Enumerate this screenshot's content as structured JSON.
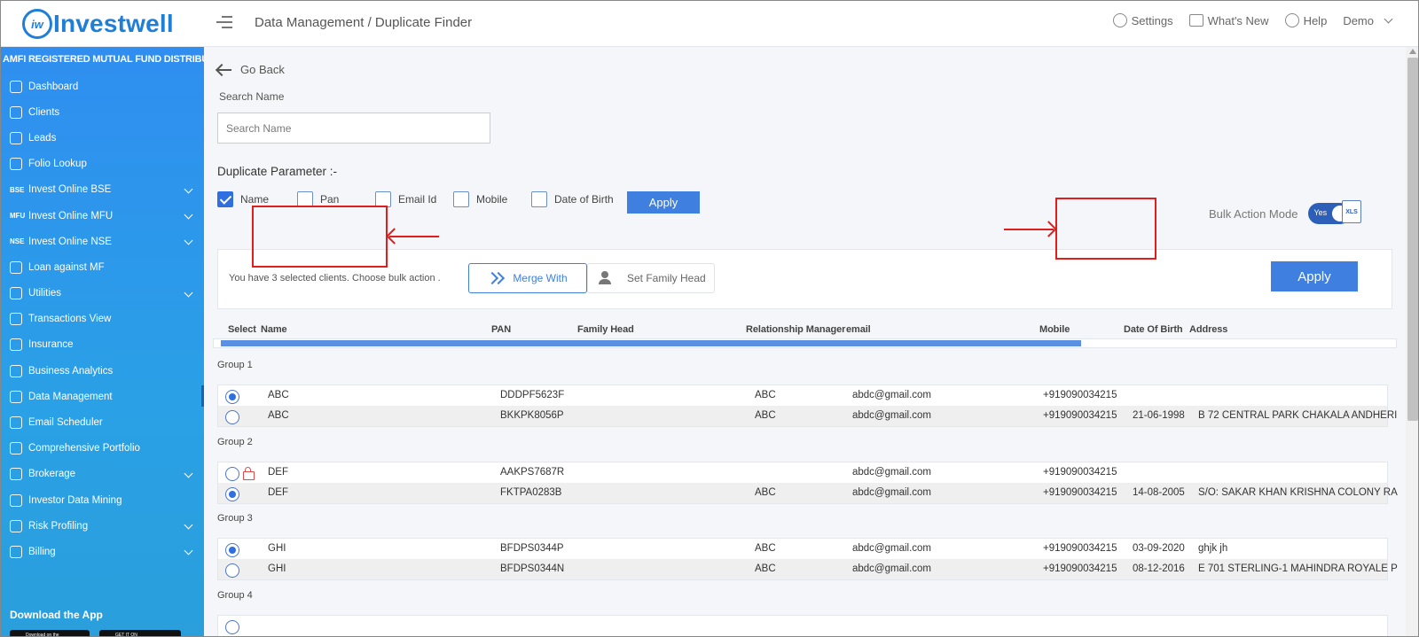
{
  "header": {
    "logo_mark": "iw",
    "logo_text": "Investwell",
    "breadcrumb": "Data Management / Duplicate Finder",
    "settings": "Settings",
    "whats_new": "What's New",
    "help": "Help",
    "user": "Demo"
  },
  "sidebar": {
    "org": "AMFI REGISTERED MUTUAL FUND DISTRIBUTOR",
    "items": [
      {
        "label": "Dashboard",
        "icon": "home-icon"
      },
      {
        "label": "Clients",
        "icon": "clients-icon"
      },
      {
        "label": "Leads",
        "icon": "leads-icon"
      },
      {
        "label": "Folio Lookup",
        "icon": "rupee-icon"
      },
      {
        "label": "Invest Online BSE",
        "tag": "BSE"
      },
      {
        "label": "Invest Online MFU",
        "tag": "MFU"
      },
      {
        "label": "Invest Online NSE",
        "tag": "NSE"
      },
      {
        "label": "Loan against MF",
        "icon": "loan-icon"
      },
      {
        "label": "Utilities",
        "icon": "utilities-icon"
      },
      {
        "label": "Transactions View",
        "icon": "transfer-icon"
      },
      {
        "label": "Insurance",
        "icon": "insurance-icon"
      },
      {
        "label": "Business Analytics",
        "icon": "analytics-icon"
      },
      {
        "label": "Data Management",
        "icon": "data-icon"
      },
      {
        "label": "Email Scheduler",
        "icon": "email-icon"
      },
      {
        "label": "Comprehensive Portfolio",
        "icon": "portfolio-icon"
      },
      {
        "label": "Brokerage",
        "icon": "brokerage-icon"
      },
      {
        "label": "Investor Data Mining",
        "icon": "mining-icon"
      },
      {
        "label": "Risk Profiling",
        "icon": "risk-icon"
      },
      {
        "label": "Billing",
        "icon": "billing-icon"
      }
    ],
    "download_label": "Download the App",
    "app_store": "Download on the",
    "play_store": "GET IT ON"
  },
  "page": {
    "go_back": "Go Back",
    "search_label": "Search Name",
    "search_placeholder": "Search Name",
    "search_value": "",
    "dup_label": "Duplicate Parameter :-",
    "params": [
      {
        "label": "Name",
        "checked": true
      },
      {
        "label": "Pan",
        "checked": false
      },
      {
        "label": "Email Id",
        "checked": false
      },
      {
        "label": "Mobile",
        "checked": false
      },
      {
        "label": "Date of Birth",
        "checked": false
      }
    ],
    "param_apply": "Apply",
    "bulk_mode_label": "Bulk Action Mode",
    "bulk_mode_value": "Yes",
    "xls_label": "XLS"
  },
  "bulk": {
    "message": "You have 3 selected clients. Choose bulk action .",
    "merge": "Merge With",
    "family_head": "Set Family Head",
    "apply": "Apply"
  },
  "table": {
    "columns": [
      "Select",
      "Name",
      "PAN",
      "Family Head",
      "Relationship Manager",
      "email",
      "Mobile",
      "Date Of Birth",
      "Address"
    ],
    "groups": [
      {
        "label": "Group 1",
        "rows": [
          {
            "selected": true,
            "locked": false,
            "name": "ABC",
            "pan": "DDDPF5623F",
            "rm": "ABC",
            "email": "abdc@gmail.com",
            "mobile": "+919090034215",
            "dob": "",
            "address": ""
          },
          {
            "selected": false,
            "locked": false,
            "name": "ABC",
            "pan": "BKKPK8056P",
            "rm": "ABC",
            "email": "abdc@gmail.com",
            "mobile": "+919090034215",
            "dob": "21-06-1998",
            "address": "B 72 CENTRAL PARK CHAKALA ANDHERI"
          }
        ]
      },
      {
        "label": "Group 2",
        "rows": [
          {
            "selected": false,
            "locked": true,
            "name": "DEF",
            "pan": "AAKPS7687R",
            "rm": "",
            "email": "abdc@gmail.com",
            "mobile": "+919090034215",
            "dob": "",
            "address": ""
          },
          {
            "selected": true,
            "locked": false,
            "name": "DEF",
            "pan": "FKTPA0283B",
            "rm": "ABC",
            "email": "abdc@gmail.com",
            "mobile": "+919090034215",
            "dob": "14-08-2005",
            "address": "S/O: SAKAR KHAN KRISHNA COLONY RA"
          }
        ]
      },
      {
        "label": "Group 3",
        "rows": [
          {
            "selected": true,
            "locked": false,
            "name": "GHI",
            "pan": "BFDPS0344P",
            "rm": "ABC",
            "email": "abdc@gmail.com",
            "mobile": "+919090034215",
            "dob": "03-09-2020",
            "address": "ghjk jh"
          },
          {
            "selected": false,
            "locked": false,
            "name": "GHI",
            "pan": "BFDPS0344N",
            "rm": "ABC",
            "email": "abdc@gmail.com",
            "mobile": "+919090034215",
            "dob": "08-12-2016",
            "address": "E 701 STERLING-1 MAHINDRA ROYALE P"
          }
        ]
      },
      {
        "label": "Group 4",
        "rows": []
      }
    ]
  },
  "colors": {
    "accent": "#3f7fe0",
    "sidebar": "#2f8ef0",
    "annotation": "#e01e1e"
  }
}
